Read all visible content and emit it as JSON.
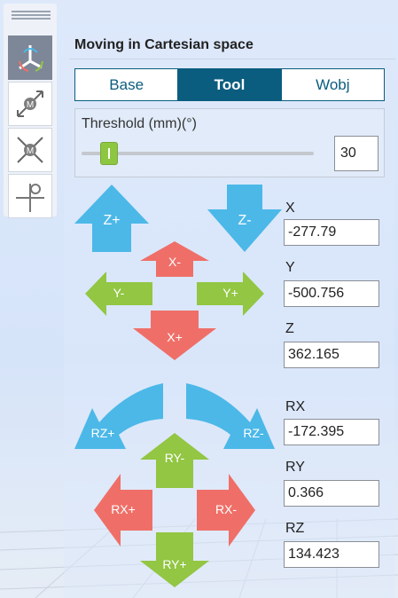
{
  "panel": {
    "title": "Moving in Cartesian space"
  },
  "toolbar": {
    "items": [
      {
        "name": "cartesian-axes-icon"
      },
      {
        "name": "linear-motion-icon"
      },
      {
        "name": "reorient-motion-icon"
      },
      {
        "name": "position-pin-icon"
      }
    ]
  },
  "frames": {
    "options": [
      "Base",
      "Tool",
      "Wobj"
    ],
    "selected": "Tool"
  },
  "threshold": {
    "label": "Threshold (mm)(°)",
    "value": "30"
  },
  "jog": {
    "z_plus": "Z+",
    "z_minus": "Z-",
    "x_minus": "X-",
    "x_plus": "X+",
    "y_minus": "Y-",
    "y_plus": "Y+",
    "rz_plus": "RZ+",
    "rz_minus": "RZ-",
    "ry_minus": "RY-",
    "ry_plus": "RY+",
    "rx_plus": "RX+",
    "rx_minus": "RX-"
  },
  "coords": {
    "x": {
      "label": "X",
      "value": "-277.79"
    },
    "y": {
      "label": "Y",
      "value": "-500.756"
    },
    "z": {
      "label": "Z",
      "value": "362.165"
    },
    "rx": {
      "label": "RX",
      "value": "-172.395"
    },
    "ry": {
      "label": "RY",
      "value": "0.366"
    },
    "rz": {
      "label": "RZ",
      "value": "134.423"
    }
  },
  "colors": {
    "blue": "#4bb8e8",
    "red": "#ef6f68",
    "green": "#92c643",
    "accent": "#0b5d7f"
  }
}
